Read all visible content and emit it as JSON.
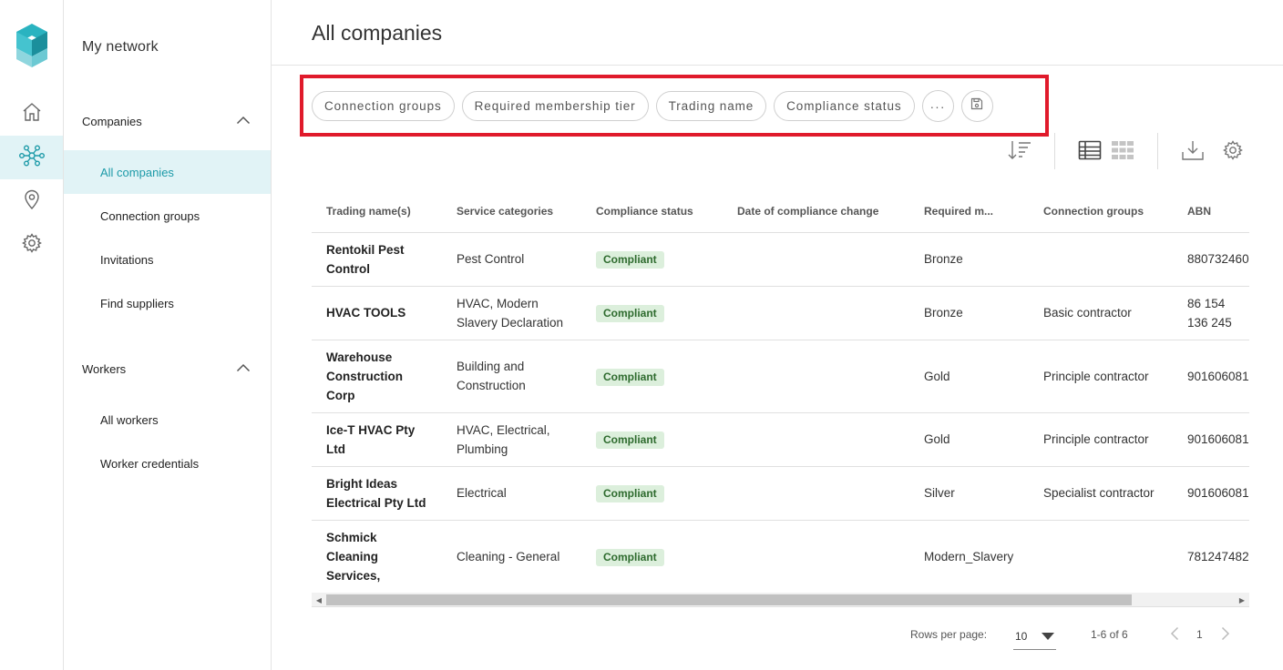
{
  "rail": {
    "items": [
      {
        "icon": "home-icon"
      },
      {
        "icon": "network-icon",
        "active": true
      },
      {
        "icon": "location-pin-icon"
      },
      {
        "icon": "gear-icon"
      }
    ]
  },
  "sidenav": {
    "title": "My network",
    "sections": [
      {
        "label": "Companies",
        "items": [
          "All companies",
          "Connection groups",
          "Invitations",
          "Find suppliers"
        ]
      },
      {
        "label": "Workers",
        "items": [
          "All workers",
          "Worker credentials"
        ]
      }
    ],
    "active_item": "All companies"
  },
  "page": {
    "title": "All companies",
    "filter_chips": [
      "Connection groups",
      "Required membership tier",
      "Trading name",
      "Compliance status"
    ],
    "more_chip": "···"
  },
  "table": {
    "columns": [
      "Trading name(s)",
      "Service categories",
      "Compliance status",
      "Date of compliance change",
      "Required m...",
      "Connection groups",
      "ABN"
    ],
    "rows": [
      {
        "name": "Rentokil Pest Control",
        "service": "Pest Control",
        "status": "Compliant",
        "date": "",
        "tier": "Bronze",
        "group": "",
        "abn": "880732460"
      },
      {
        "name": "HVAC TOOLS",
        "service": "HVAC, Modern Slavery Declaration",
        "status": "Compliant",
        "date": "",
        "tier": "Bronze",
        "group": "Basic contractor",
        "abn": "86 154 136 245"
      },
      {
        "name": "Warehouse Construction Corp",
        "service": "Building and Construction",
        "status": "Compliant",
        "date": "",
        "tier": "Gold",
        "group": "Principle contractor",
        "abn": "901606081"
      },
      {
        "name": "Ice-T HVAC Pty Ltd",
        "service": "HVAC, Electrical, Plumbing",
        "status": "Compliant",
        "date": "",
        "tier": "Gold",
        "group": "Principle contractor",
        "abn": "901606081"
      },
      {
        "name": "Bright Ideas Electrical Pty Ltd",
        "service": "Electrical",
        "status": "Compliant",
        "date": "",
        "tier": "Silver",
        "group": "Specialist contractor",
        "abn": "901606081"
      },
      {
        "name": "Schmick Cleaning Services, Jones...",
        "service": "Cleaning - General",
        "status": "Compliant",
        "date": "",
        "tier": "Modern_Slavery",
        "group": "",
        "abn": "781247482"
      }
    ]
  },
  "pagination": {
    "rows_label": "Rows per page:",
    "rows_value": "10",
    "range": "1-6 of 6",
    "page": "1"
  },
  "colors": {
    "accent": "#1c9aa8",
    "active_bg": "#e1f3f6",
    "highlight_box": "#e01a2b",
    "badge_bg": "#dcefdc",
    "badge_text": "#2e6b2e"
  }
}
